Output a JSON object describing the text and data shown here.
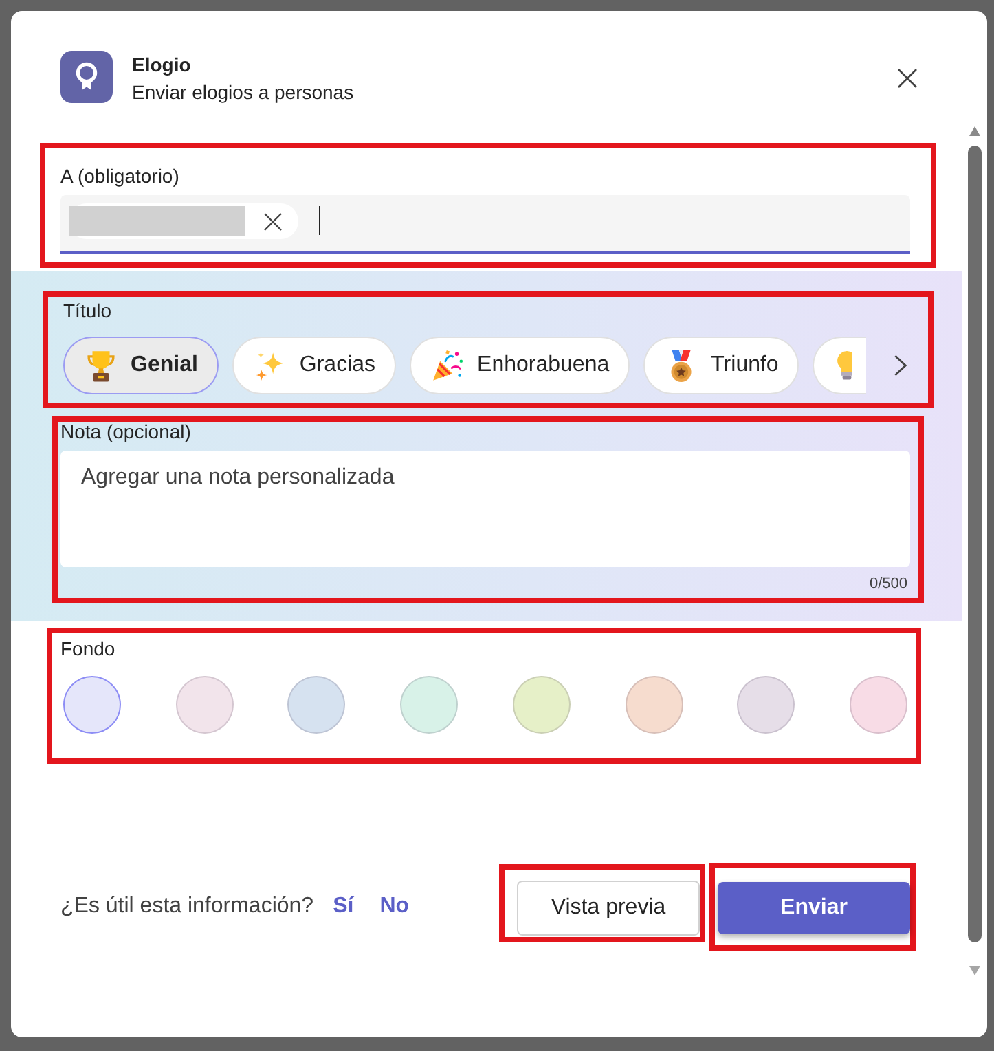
{
  "header": {
    "title": "Elogio",
    "subtitle": "Enviar elogios a personas"
  },
  "recipient": {
    "label": "A (obligatorio)",
    "highlighted": true,
    "focused": true,
    "chips": [
      {
        "redacted": true
      }
    ]
  },
  "title": {
    "label": "Título",
    "highlighted": true,
    "options": [
      {
        "label": "Genial",
        "selected": true
      },
      {
        "label": "Gracias",
        "selected": false
      },
      {
        "label": "Enhorabuena",
        "selected": false
      },
      {
        "label": "Triunfo",
        "selected": false
      },
      {
        "selected": false
      }
    ]
  },
  "note": {
    "label": "Nota (opcional)",
    "highlighted": true,
    "placeholder": "Agregar una nota personalizada",
    "counter": "0/500"
  },
  "background": {
    "label": "Fondo",
    "highlighted": true,
    "swatches": [
      {
        "color": "#e5e6fa",
        "selected": true
      },
      {
        "color": "#f2e4eb",
        "selected": false
      },
      {
        "color": "#d6e2f0",
        "selected": false
      },
      {
        "color": "#d8f2e8",
        "selected": false
      },
      {
        "color": "#e6f0c8",
        "selected": false
      },
      {
        "color": "#f6dcce",
        "selected": false
      },
      {
        "color": "#e6dee8",
        "selected": false
      },
      {
        "color": "#f8dce6",
        "selected": false
      }
    ]
  },
  "footer": {
    "question": "¿Es útil esta información?",
    "links": [
      "Sí",
      "No"
    ],
    "buttons": [
      {
        "kind": "secondary",
        "label": "Vista previa",
        "highlighted": true
      },
      {
        "kind": "primary",
        "label": "Enviar",
        "highlighted": true
      }
    ]
  }
}
